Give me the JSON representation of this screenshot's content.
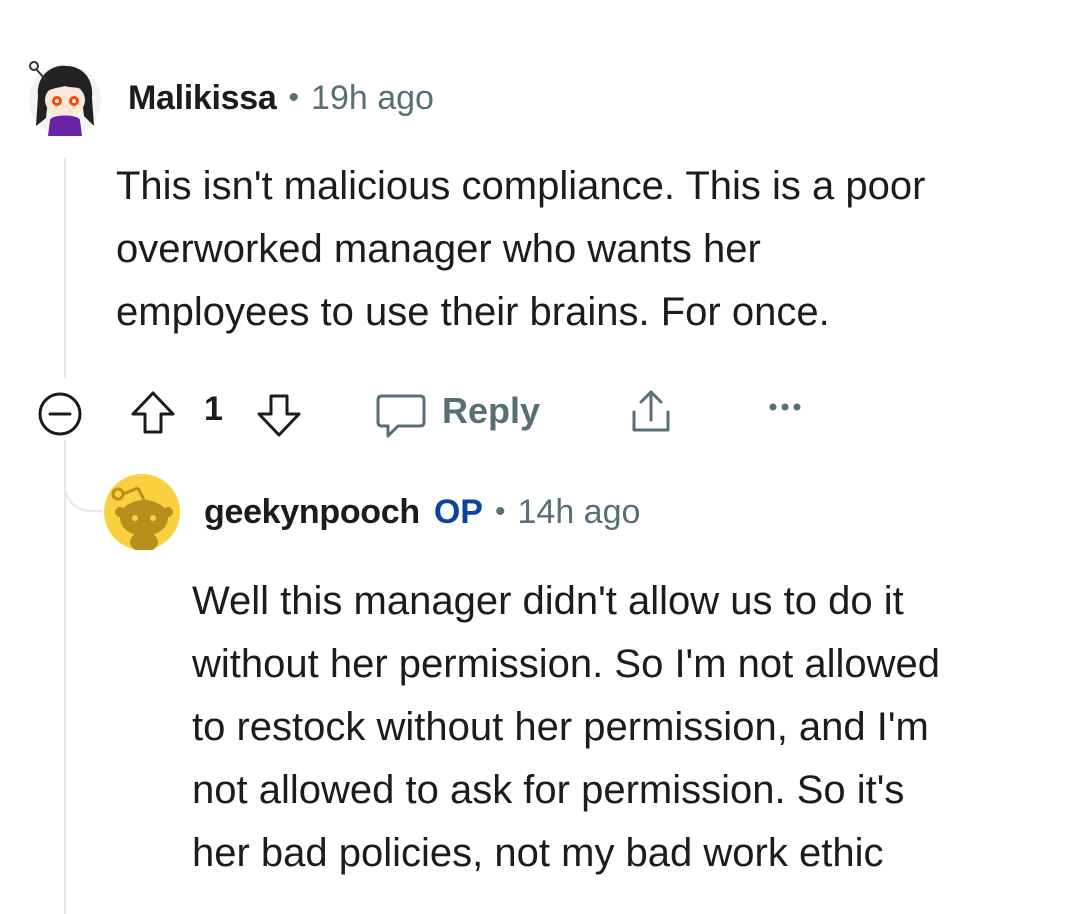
{
  "comment": {
    "username": "Malikissa",
    "separator": "•",
    "time": "19h ago",
    "body": [
      "This isn't malicious compliance. This is a poor",
      "overworked manager who wants her",
      "employees to use their brains. For once."
    ],
    "actions": {
      "vote_count": "1",
      "reply_label": "Reply"
    },
    "avatar_icon": "user-avatar-icon"
  },
  "reply": {
    "username": "geekynpooch",
    "op_badge": "OP",
    "separator": "•",
    "time": "14h ago",
    "body": [
      "Well this manager didn't allow us to do it",
      "without her permission. So I'm not allowed",
      "to restock without her permission, and I'm",
      "not allowed to ask for permission. So it's",
      "her bad policies, not my bad work ethic"
    ],
    "avatar_icon": "snoo-avatar-icon"
  },
  "colors": {
    "meta_gray": "#576f76",
    "op_blue": "#0a449b",
    "thread_line": "#e5e7e9",
    "avatar_yellow": "#f9d03f"
  }
}
